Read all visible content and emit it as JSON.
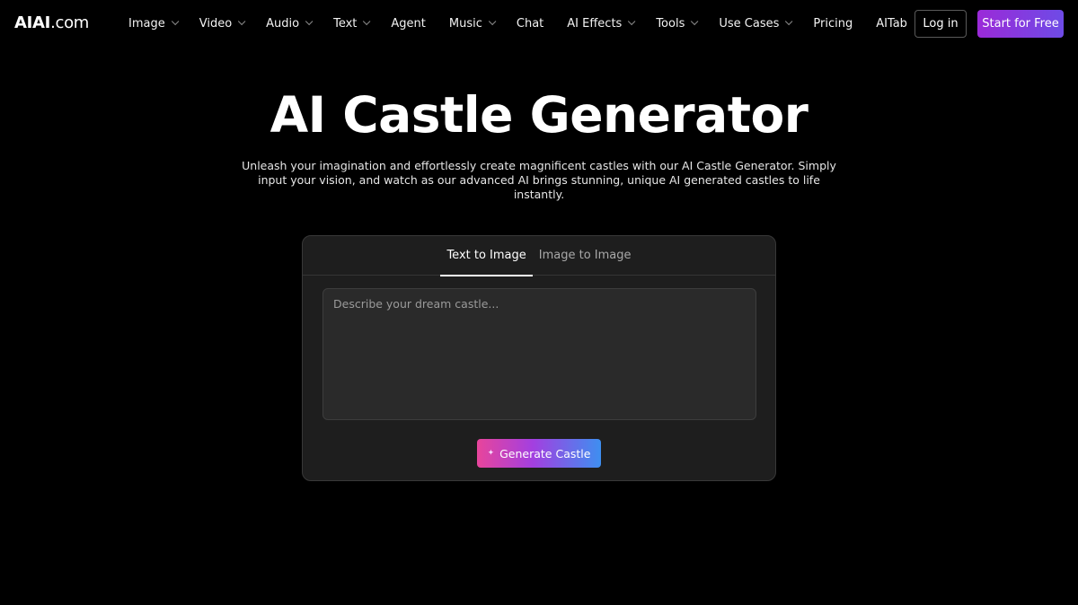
{
  "brand": {
    "logo_strong": "AIAI",
    "logo_light": ".com"
  },
  "nav": {
    "items": [
      {
        "label": "Image",
        "dropdown": true
      },
      {
        "label": "Video",
        "dropdown": true
      },
      {
        "label": "Audio",
        "dropdown": true
      },
      {
        "label": "Text",
        "dropdown": true
      },
      {
        "label": "Agent",
        "dropdown": false
      },
      {
        "label": "Music",
        "dropdown": true
      },
      {
        "label": "Chat",
        "dropdown": false
      },
      {
        "label": "AI Effects",
        "dropdown": true
      },
      {
        "label": "Tools",
        "dropdown": true
      },
      {
        "label": "Use Cases",
        "dropdown": true
      },
      {
        "label": "Pricing",
        "dropdown": false
      },
      {
        "label": "AITab",
        "dropdown": false
      }
    ],
    "login_label": "Log in",
    "start_label": "Start for Free"
  },
  "hero": {
    "title": "AI Castle Generator",
    "description": "Unleash your imagination and effortlessly create magnificent castles with our AI Castle Generator. Simply input your vision, and watch as our advanced AI brings stunning, unique AI generated castles to life instantly."
  },
  "generator": {
    "tabs": [
      {
        "label": "Text to Image",
        "active": true
      },
      {
        "label": "Image to Image",
        "active": false
      }
    ],
    "prompt_value": "",
    "prompt_placeholder": "Describe your dream castle...",
    "generate_label": "Generate Castle",
    "generate_icon": "sparkle-icon"
  },
  "colors": {
    "background": "#000000",
    "card": "#1e1e1e",
    "start_button": "#9b2ad8",
    "generate_gradient_start": "#e8459b",
    "generate_gradient_end": "#3e8ff0"
  }
}
